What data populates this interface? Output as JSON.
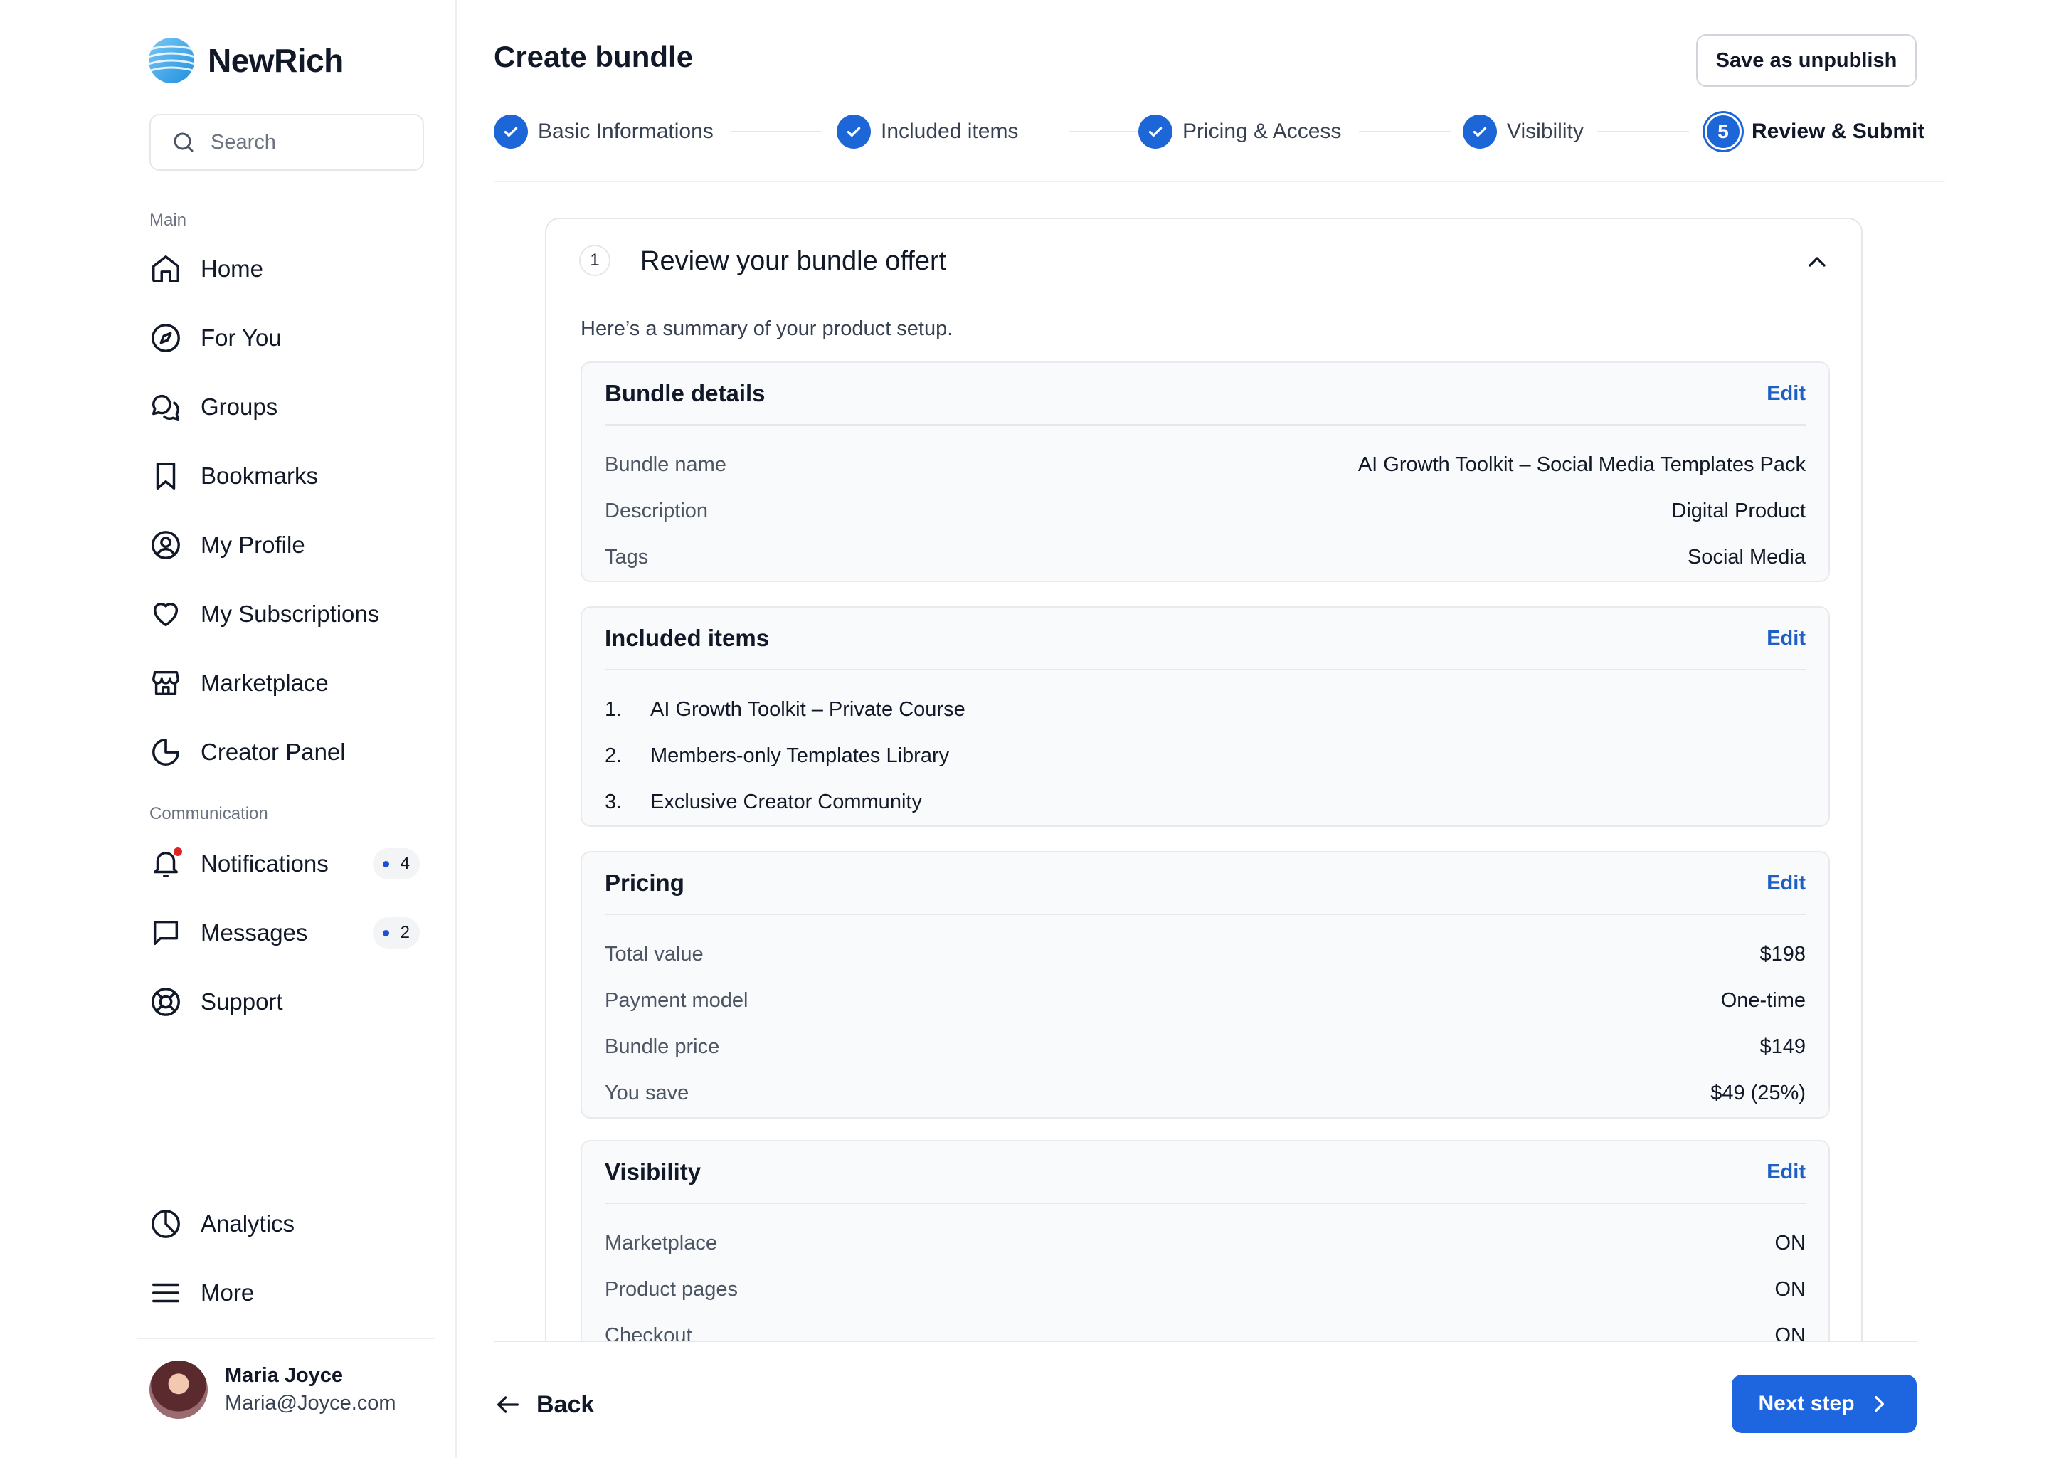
{
  "brand": {
    "name": "NewRich",
    "logo_icon": "globe-waves-icon",
    "accent": "#1d66e0"
  },
  "search": {
    "placeholder": "Search"
  },
  "sidebar": {
    "main_label": "Main",
    "main_items": [
      {
        "label": "Home",
        "icon": "home-icon"
      },
      {
        "label": "For You",
        "icon": "compass-icon"
      },
      {
        "label": "Groups",
        "icon": "chat-bubbles-icon"
      },
      {
        "label": "Bookmarks",
        "icon": "bookmark-icon"
      },
      {
        "label": "My Profile",
        "icon": "user-circle-icon"
      },
      {
        "label": "My Subscriptions",
        "icon": "heart-icon"
      },
      {
        "label": "Marketplace",
        "icon": "store-icon"
      },
      {
        "label": "Creator Panel",
        "icon": "pie-chart-icon"
      }
    ],
    "communication_label": "Communication",
    "communication_items": [
      {
        "label": "Notifications",
        "icon": "bell-icon",
        "count": "4"
      },
      {
        "label": "Messages",
        "icon": "message-icon",
        "count": "2"
      },
      {
        "label": "Support",
        "icon": "lifebuoy-icon"
      }
    ],
    "bottom_items": [
      {
        "label": "Analytics",
        "icon": "clock-chart-icon"
      },
      {
        "label": "More",
        "icon": "menu-icon"
      }
    ]
  },
  "user": {
    "name": "Maria Joyce",
    "email": "Maria@Joyce.com"
  },
  "header": {
    "title": "Create bundle",
    "save_label": "Save as unpublish"
  },
  "steps": [
    {
      "label": "Basic Informations",
      "status": "done"
    },
    {
      "label": "Included items",
      "status": "done"
    },
    {
      "label": "Pricing & Access",
      "status": "done"
    },
    {
      "label": "Visibility",
      "status": "done"
    },
    {
      "label": "Review & Submit",
      "status": "active",
      "number": "5"
    }
  ],
  "review": {
    "number": "1",
    "title": "Review your bundle offert",
    "description": "Here’s a summary of your product setup.",
    "edit_label": "Edit",
    "bundle_details": {
      "title": "Bundle details",
      "rows": [
        {
          "key": "Bundle name",
          "value": "AI Growth Toolkit – Social Media Templates Pack"
        },
        {
          "key": "Description",
          "value": "Digital Product"
        },
        {
          "key": "Tags",
          "value": "Social Media"
        }
      ]
    },
    "included_items": {
      "title": "Included items",
      "items": [
        {
          "index": "1.",
          "label": "AI Growth Toolkit – Private Course"
        },
        {
          "index": "2.",
          "label": "Members-only Templates Library"
        },
        {
          "index": "3.",
          "label": "Exclusive Creator Community"
        }
      ]
    },
    "pricing": {
      "title": "Pricing",
      "rows": [
        {
          "key": "Total value",
          "value": "$198"
        },
        {
          "key": "Payment model",
          "value": "One-time"
        },
        {
          "key": "Bundle price",
          "value": "$149"
        },
        {
          "key": "You save",
          "value": "$49 (25%)"
        }
      ]
    },
    "visibility": {
      "title": "Visibility",
      "rows": [
        {
          "key": "Marketplace",
          "value": "ON"
        },
        {
          "key": "Product pages",
          "value": "ON"
        },
        {
          "key": "Checkout",
          "value": "ON"
        }
      ]
    }
  },
  "footer": {
    "back_label": "Back",
    "next_label": "Next step"
  }
}
